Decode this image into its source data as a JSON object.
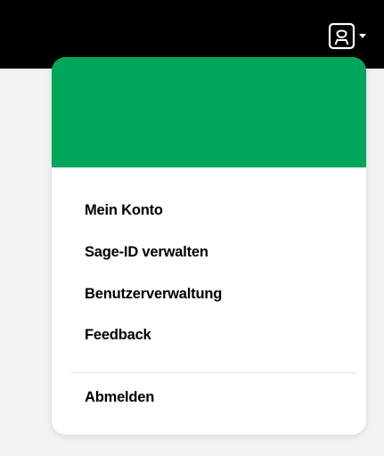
{
  "header": {
    "user_icon": "user-avatar-icon",
    "caret_icon": "chevron-down-icon"
  },
  "colors": {
    "topbar": "#000000",
    "menu_header": "#00a65a",
    "background": "#f2f2f2"
  },
  "user_menu": {
    "items": [
      {
        "label": "Mein Konto"
      },
      {
        "label": "Sage-ID verwalten"
      },
      {
        "label": "Benutzerverwaltung"
      },
      {
        "label": "Feedback"
      }
    ],
    "logout_label": "Abmelden"
  }
}
